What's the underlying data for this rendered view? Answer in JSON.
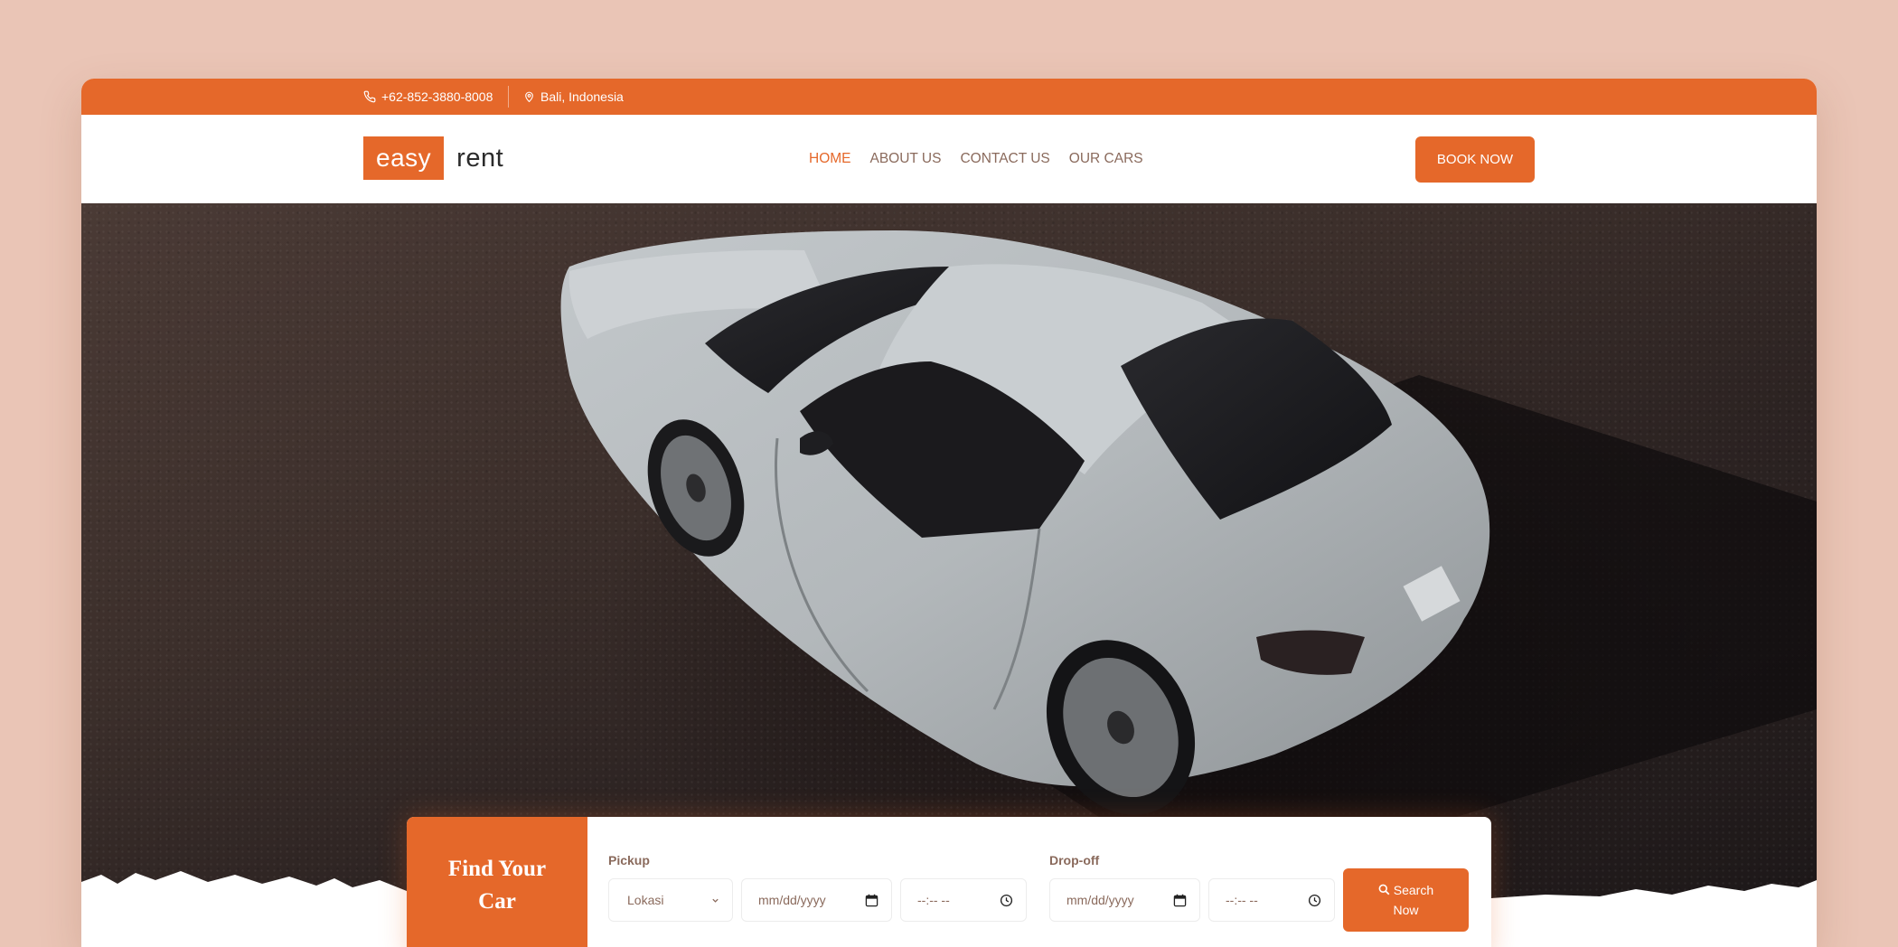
{
  "topbar": {
    "phone": "+62-852-3880-8008",
    "location": "Bali, Indonesia"
  },
  "brand": {
    "part1": "easy",
    "part2": "rent"
  },
  "nav": {
    "items": [
      {
        "label": "HOME",
        "active": true
      },
      {
        "label": "ABOUT US",
        "active": false
      },
      {
        "label": "CONTACT US",
        "active": false
      },
      {
        "label": "OUR CARS",
        "active": false
      }
    ],
    "cta": "BOOK NOW"
  },
  "finder": {
    "title_line1": "Find Your",
    "title_line2": "Car",
    "pickup_label": "Pickup",
    "dropoff_label": "Drop-off",
    "location_placeholder": "Lokasi",
    "date_placeholder": "mm/dd/yyyy",
    "time_placeholder": "--:-- --",
    "search_line1": "Search",
    "search_line2": "Now"
  },
  "colors": {
    "accent": "#e5682a",
    "page_bg": "#eac5b6",
    "muted_text": "#8a6a5c"
  },
  "icons": {
    "phone": "phone-icon",
    "location": "map-pin-icon",
    "dropdown": "chevron-down-icon",
    "calendar": "calendar-icon",
    "clock": "clock-icon",
    "search": "search-icon"
  }
}
